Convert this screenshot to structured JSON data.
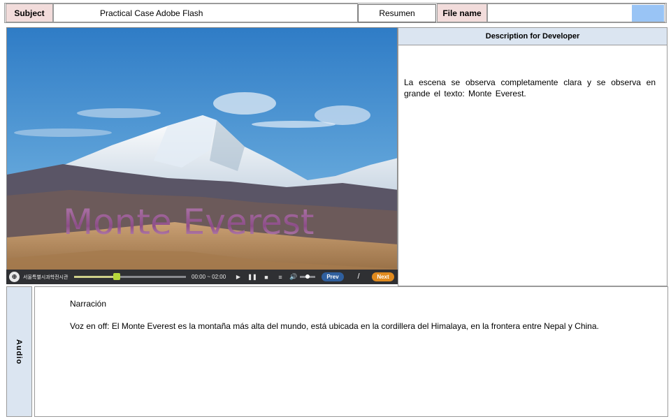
{
  "header": {
    "subject_label": "Subject",
    "subject_value": "Practical Case Adobe Flash",
    "resumen_button": "Resumen",
    "filename_label": "File name",
    "filename_value": ""
  },
  "media": {
    "title_overlay": "Monte Everest",
    "player": {
      "brand_text": "서울특별시과학전시관",
      "time_display": "00:00 ~ 02:00",
      "progress_fraction": 0.38,
      "volume_fraction": 0.5,
      "prev_label": "Prev",
      "separator": "/",
      "next_label": "Next",
      "icons": [
        "logo-icon",
        "play-icon",
        "pause-icon",
        "stop-icon",
        "menu-icon",
        "volume-icon"
      ]
    }
  },
  "description": {
    "header": "Description for Developer",
    "text": "La escena se observa completamente clara y se observa en grande el texto: Monte Everest."
  },
  "audio": {
    "side_label": "Audio",
    "narration_title": "Narración",
    "narration_text": "Voz en off: El Monte Everest es la montaña más alta del mundo, está ubicada en la cordillera del Himalaya, en la frontera entre Nepal y China."
  },
  "colors": {
    "label_bg": "#f2dcdb",
    "panel_header_bg": "#dbe5f1",
    "accent_swatch": "#99c4f5",
    "prev_button": "#2f5f9e",
    "next_button": "#e08a1e"
  }
}
